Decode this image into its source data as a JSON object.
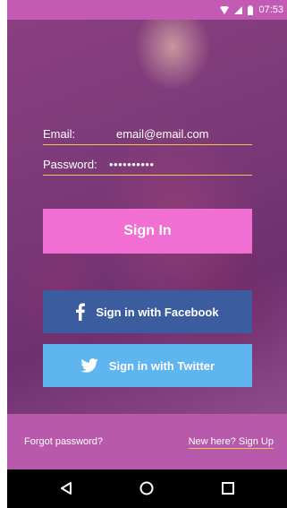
{
  "status_bar": {
    "time": "07:53",
    "icons": [
      "wifi-icon",
      "signal-icon",
      "battery-icon"
    ]
  },
  "form": {
    "email_label": "Email:",
    "email_value": "email@email.com",
    "password_label": "Password:",
    "password_value": "••••••••••"
  },
  "buttons": {
    "sign_in": "Sign In",
    "facebook": "Sign in with Facebook",
    "twitter": "Sign in with Twitter"
  },
  "footer": {
    "forgot_password": "Forgot password?",
    "sign_up": "New here? Sign Up"
  },
  "nav": [
    "back-icon",
    "home-icon",
    "recents-icon"
  ],
  "colors": {
    "status_bar": "#c35bb4",
    "sign_in_button": "#f16fd3",
    "facebook_button": "#3b5d9f",
    "twitter_button": "#5fb5f0",
    "underline": "#e3c84e",
    "footer": "#b859ab"
  }
}
